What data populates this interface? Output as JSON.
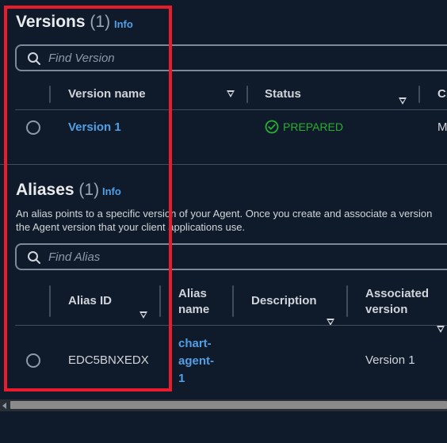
{
  "versions": {
    "title": "Versions",
    "count": "(1)",
    "info_label": "Info",
    "search_placeholder": "Find Version",
    "columns": [
      "Version name",
      "Status",
      "Cr"
    ],
    "rows": [
      {
        "name": "Version 1",
        "status": "PREPARED",
        "created": "M"
      }
    ]
  },
  "aliases": {
    "title": "Aliases",
    "count": "(1)",
    "info_label": "Info",
    "description_line1": "An alias points to a specific version of your Agent. Once you create and associate a version",
    "description_line2": "the Agent version that your client applications use.",
    "search_placeholder": "Find Alias",
    "columns": {
      "alias_id": "Alias ID",
      "alias_name_1": "Alias",
      "alias_name_2": "name",
      "description": "Description",
      "associated_1": "Associated",
      "associated_2": "version"
    },
    "rows": [
      {
        "alias_id": "EDC5BNXEDX",
        "alias_name_1": "chart-",
        "alias_name_2": "agent-",
        "alias_name_3": "1",
        "description": "",
        "associated_version": "Version 1"
      }
    ]
  },
  "colors": {
    "background": "#0f1b2a",
    "link": "#539fe5",
    "success": "#29ad32",
    "highlight": "#e81c2a"
  }
}
